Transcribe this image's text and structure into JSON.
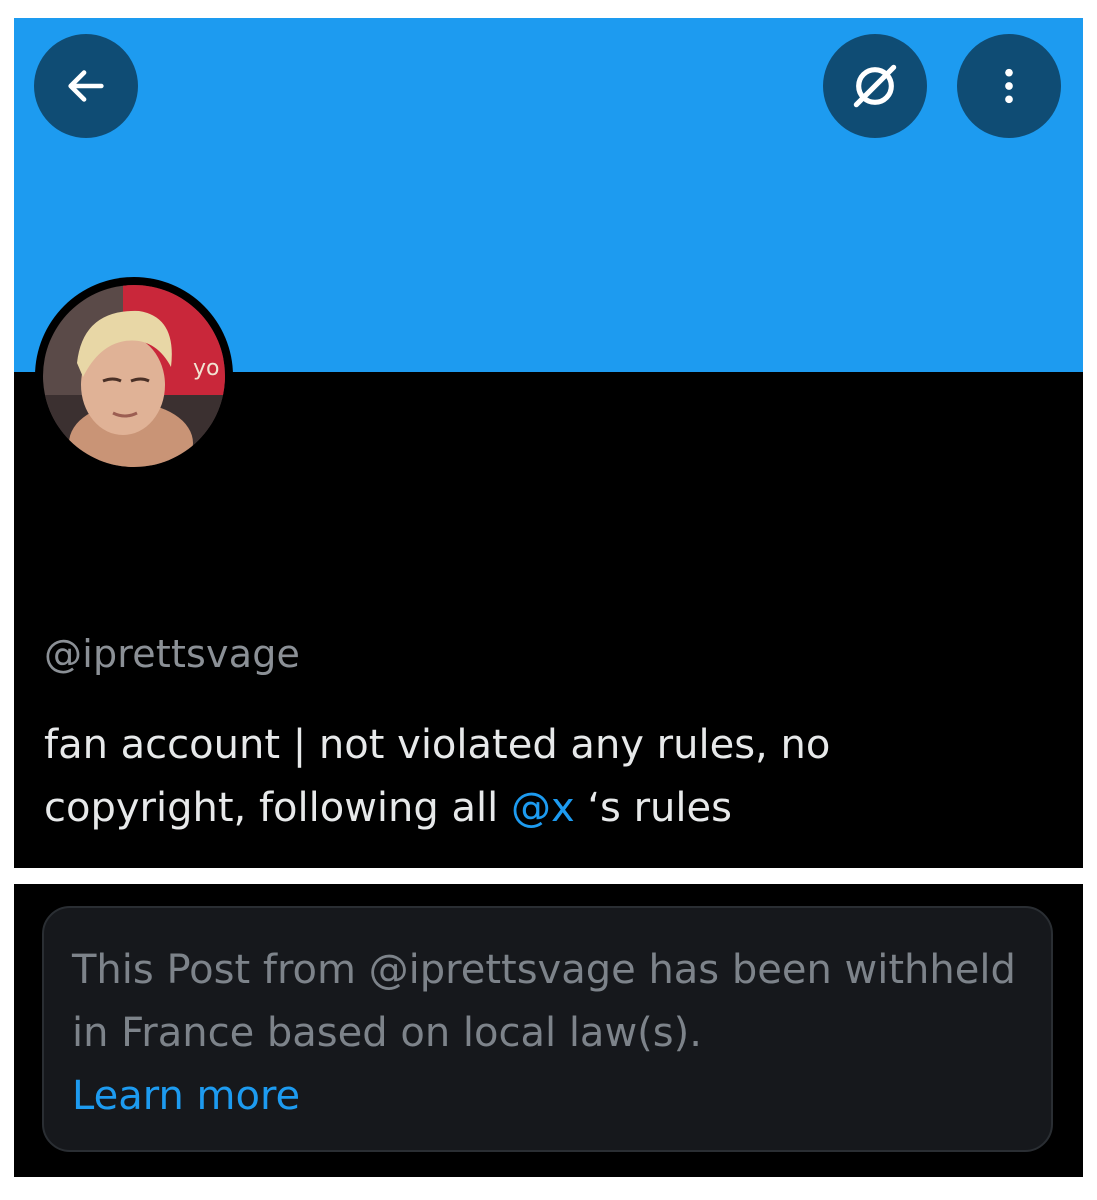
{
  "profile": {
    "handle": "@iprettsvage",
    "bio_part1": "fan account | not violated any rules, no copyright, following all ",
    "bio_mention": "@x",
    "bio_part2": " ‘s rules",
    "banner_color": "#1d9bf0"
  },
  "header": {
    "back_icon": "arrow-left-icon",
    "grok_icon": "grok-icon",
    "more_icon": "more-vertical-icon"
  },
  "notice": {
    "text": "This Post from @iprettsvage has been withheld in France based on local law(s).",
    "link_label": "Learn more"
  }
}
